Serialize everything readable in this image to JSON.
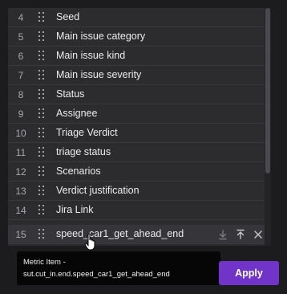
{
  "list": {
    "rows": [
      {
        "index": "4",
        "label": "Seed"
      },
      {
        "index": "5",
        "label": "Main issue category"
      },
      {
        "index": "6",
        "label": "Main issue kind"
      },
      {
        "index": "7",
        "label": "Main issue severity"
      },
      {
        "index": "8",
        "label": "Status"
      },
      {
        "index": "9",
        "label": "Assignee"
      },
      {
        "index": "10",
        "label": "Triage Verdict"
      },
      {
        "index": "11",
        "label": "triage status"
      },
      {
        "index": "12",
        "label": "Scenarios"
      },
      {
        "index": "13",
        "label": "Verdict justification"
      },
      {
        "index": "14",
        "label": "Jira Link"
      },
      {
        "index": "15",
        "label": "speed_car1_get_ahead_end"
      }
    ],
    "hovered_row_actions": [
      "move-to-bottom-icon",
      "move-to-top-icon",
      "remove-icon"
    ]
  },
  "tooltip": {
    "line1": "Metric Item -",
    "line2": "sut.cut_in.end.speed_car1_get_ahead_end"
  },
  "apply_button": {
    "label": "Apply"
  },
  "colors": {
    "background": "#1c1c1e",
    "panel": "#2c2c2e",
    "row_divider": "#3a3a3d",
    "accent": "#7034c8",
    "tooltip_bg": "#060606"
  }
}
